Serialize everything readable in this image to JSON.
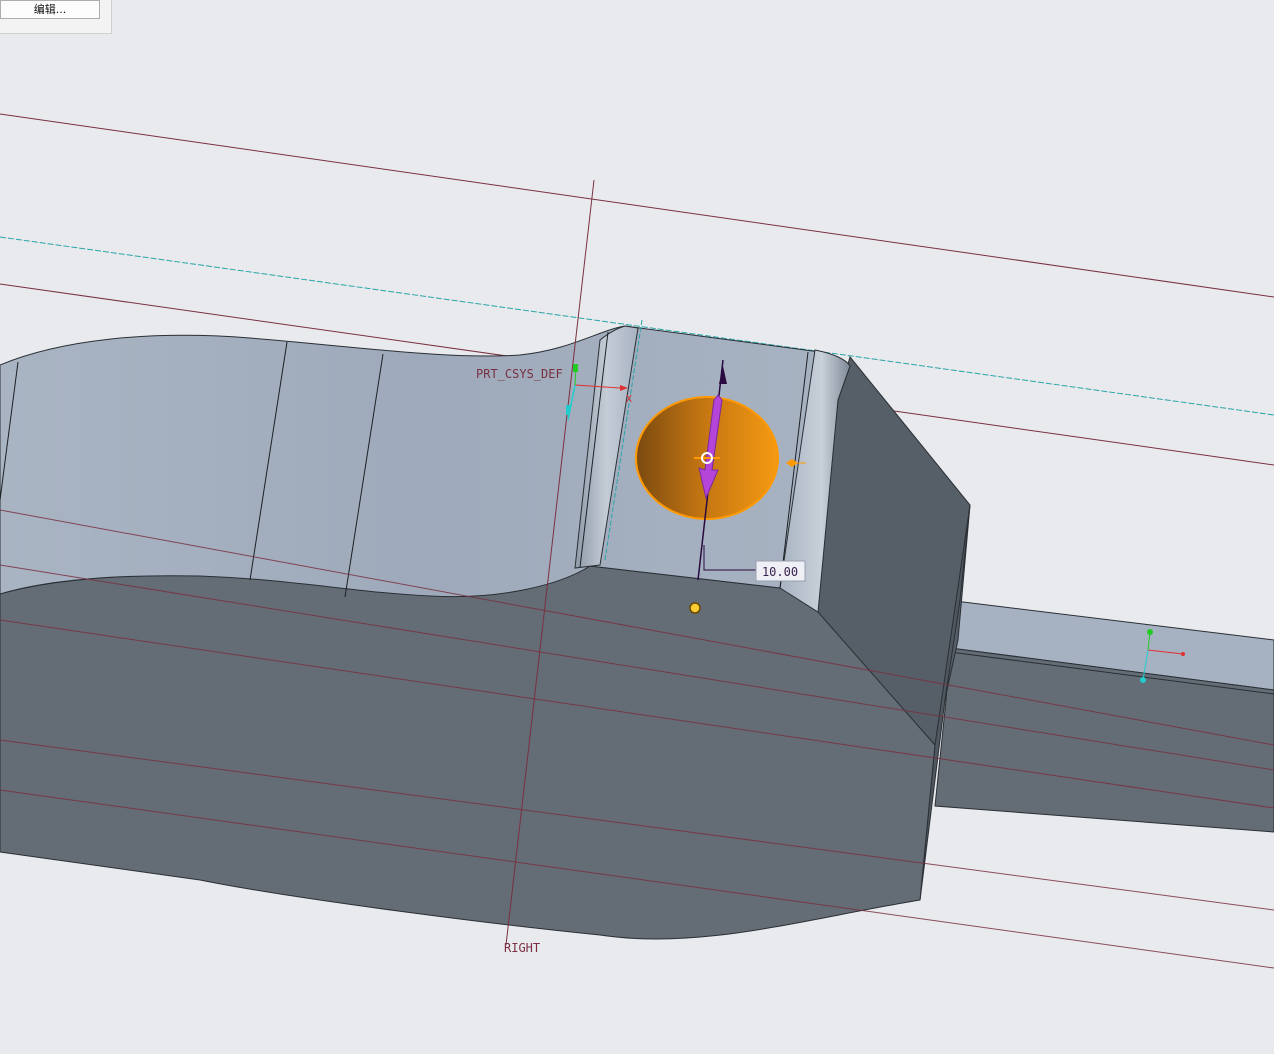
{
  "toolbar": {
    "edit_button_label": "编辑..."
  },
  "viewport": {
    "csys_label": "PRT_CSYS_DEF",
    "csys_axis_label": "X",
    "datum_plane_label": "RIGHT",
    "dimension_value": "10.00",
    "colors": {
      "top_face": "#a6b2c2",
      "side_face": "#646c75",
      "dark_face": "#565e67",
      "background": "#e8eaed",
      "datum_line": "#7a3040",
      "axis_line": "#2aa5a8",
      "selection_orange": "#ff9900",
      "drag_arrow": "#b545d8"
    }
  }
}
